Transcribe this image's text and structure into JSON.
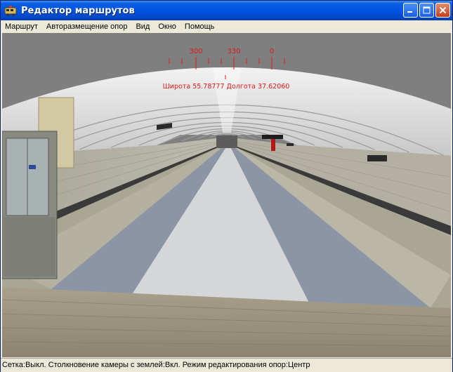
{
  "window": {
    "title": "Редактор маршрутов"
  },
  "menu": {
    "items": [
      "Маршрут",
      "Авторазмещение опор",
      "Вид",
      "Окно",
      "Помощь"
    ]
  },
  "hud": {
    "compass_labels": [
      "300",
      "330",
      "0"
    ],
    "coordinates": "Широта 55.78777 Долгота 37.62060"
  },
  "status": {
    "text": "Сетка:Выкл. Столкновение камеры с землей:Вкл. Режим редактирования опор:Центр"
  },
  "icons": {
    "app": "route-editor-app-icon",
    "minimize": "minimize-icon",
    "maximize": "maximize-icon",
    "close": "close-icon"
  },
  "colors": {
    "titlebar": "#0054e3",
    "hud": "#e01818",
    "close_button": "#c2401c"
  }
}
